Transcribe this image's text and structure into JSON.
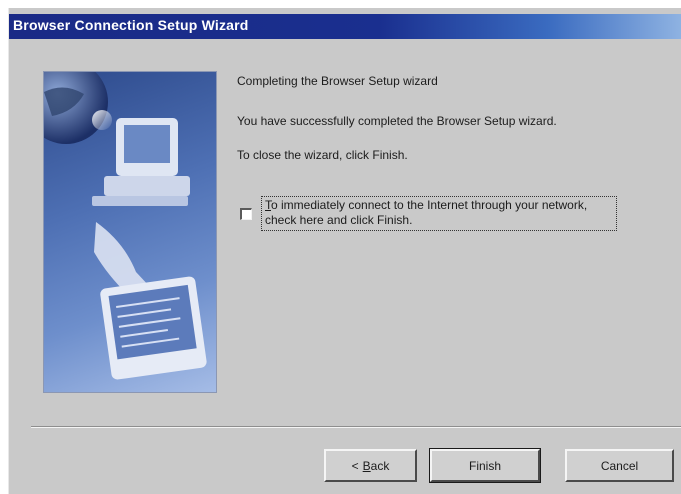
{
  "window": {
    "title": "Browser Connection Setup Wizard"
  },
  "page": {
    "heading": "Completing the Browser Setup wizard",
    "success_text": "You have successfully completed the Browser Setup wizard.",
    "close_text": "To close the wizard, click Finish."
  },
  "connect_option": {
    "checked": false,
    "label_accel": "T",
    "label_rest": "o immediately connect to the Internet through your network, check here and click Finish."
  },
  "buttons": {
    "back_prefix": "<",
    "back_accel": "B",
    "back_rest": "ack",
    "finish": "Finish",
    "cancel": "Cancel"
  },
  "colors": {
    "titlebar_start": "#1a2a86",
    "titlebar_end": "#8fb3e2",
    "dialog_face": "#c9c9c9"
  }
}
